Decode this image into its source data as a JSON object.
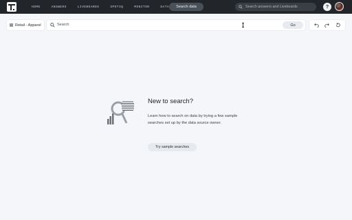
{
  "nav": {
    "links": [
      "HOME",
      "ANSWERS",
      "LIVEBOARDS",
      "SPOTIQ",
      "MONITOR",
      "DATA"
    ],
    "search_data_label": "Search data",
    "global_search_placeholder": "Search answers and Liveboards",
    "help_label": "?"
  },
  "toolbar": {
    "data_source_label": "Retail - Apparel",
    "search_placeholder": "Search",
    "go_label": "Go"
  },
  "empty_state": {
    "title": "New to search?",
    "description": "Learn how to search on data by trying a few sample searches set up by the data source owner.",
    "cta_label": "Try sample searches"
  },
  "colors": {
    "nav_bg": "#22262b",
    "page_bg": "#f4f6f9"
  }
}
